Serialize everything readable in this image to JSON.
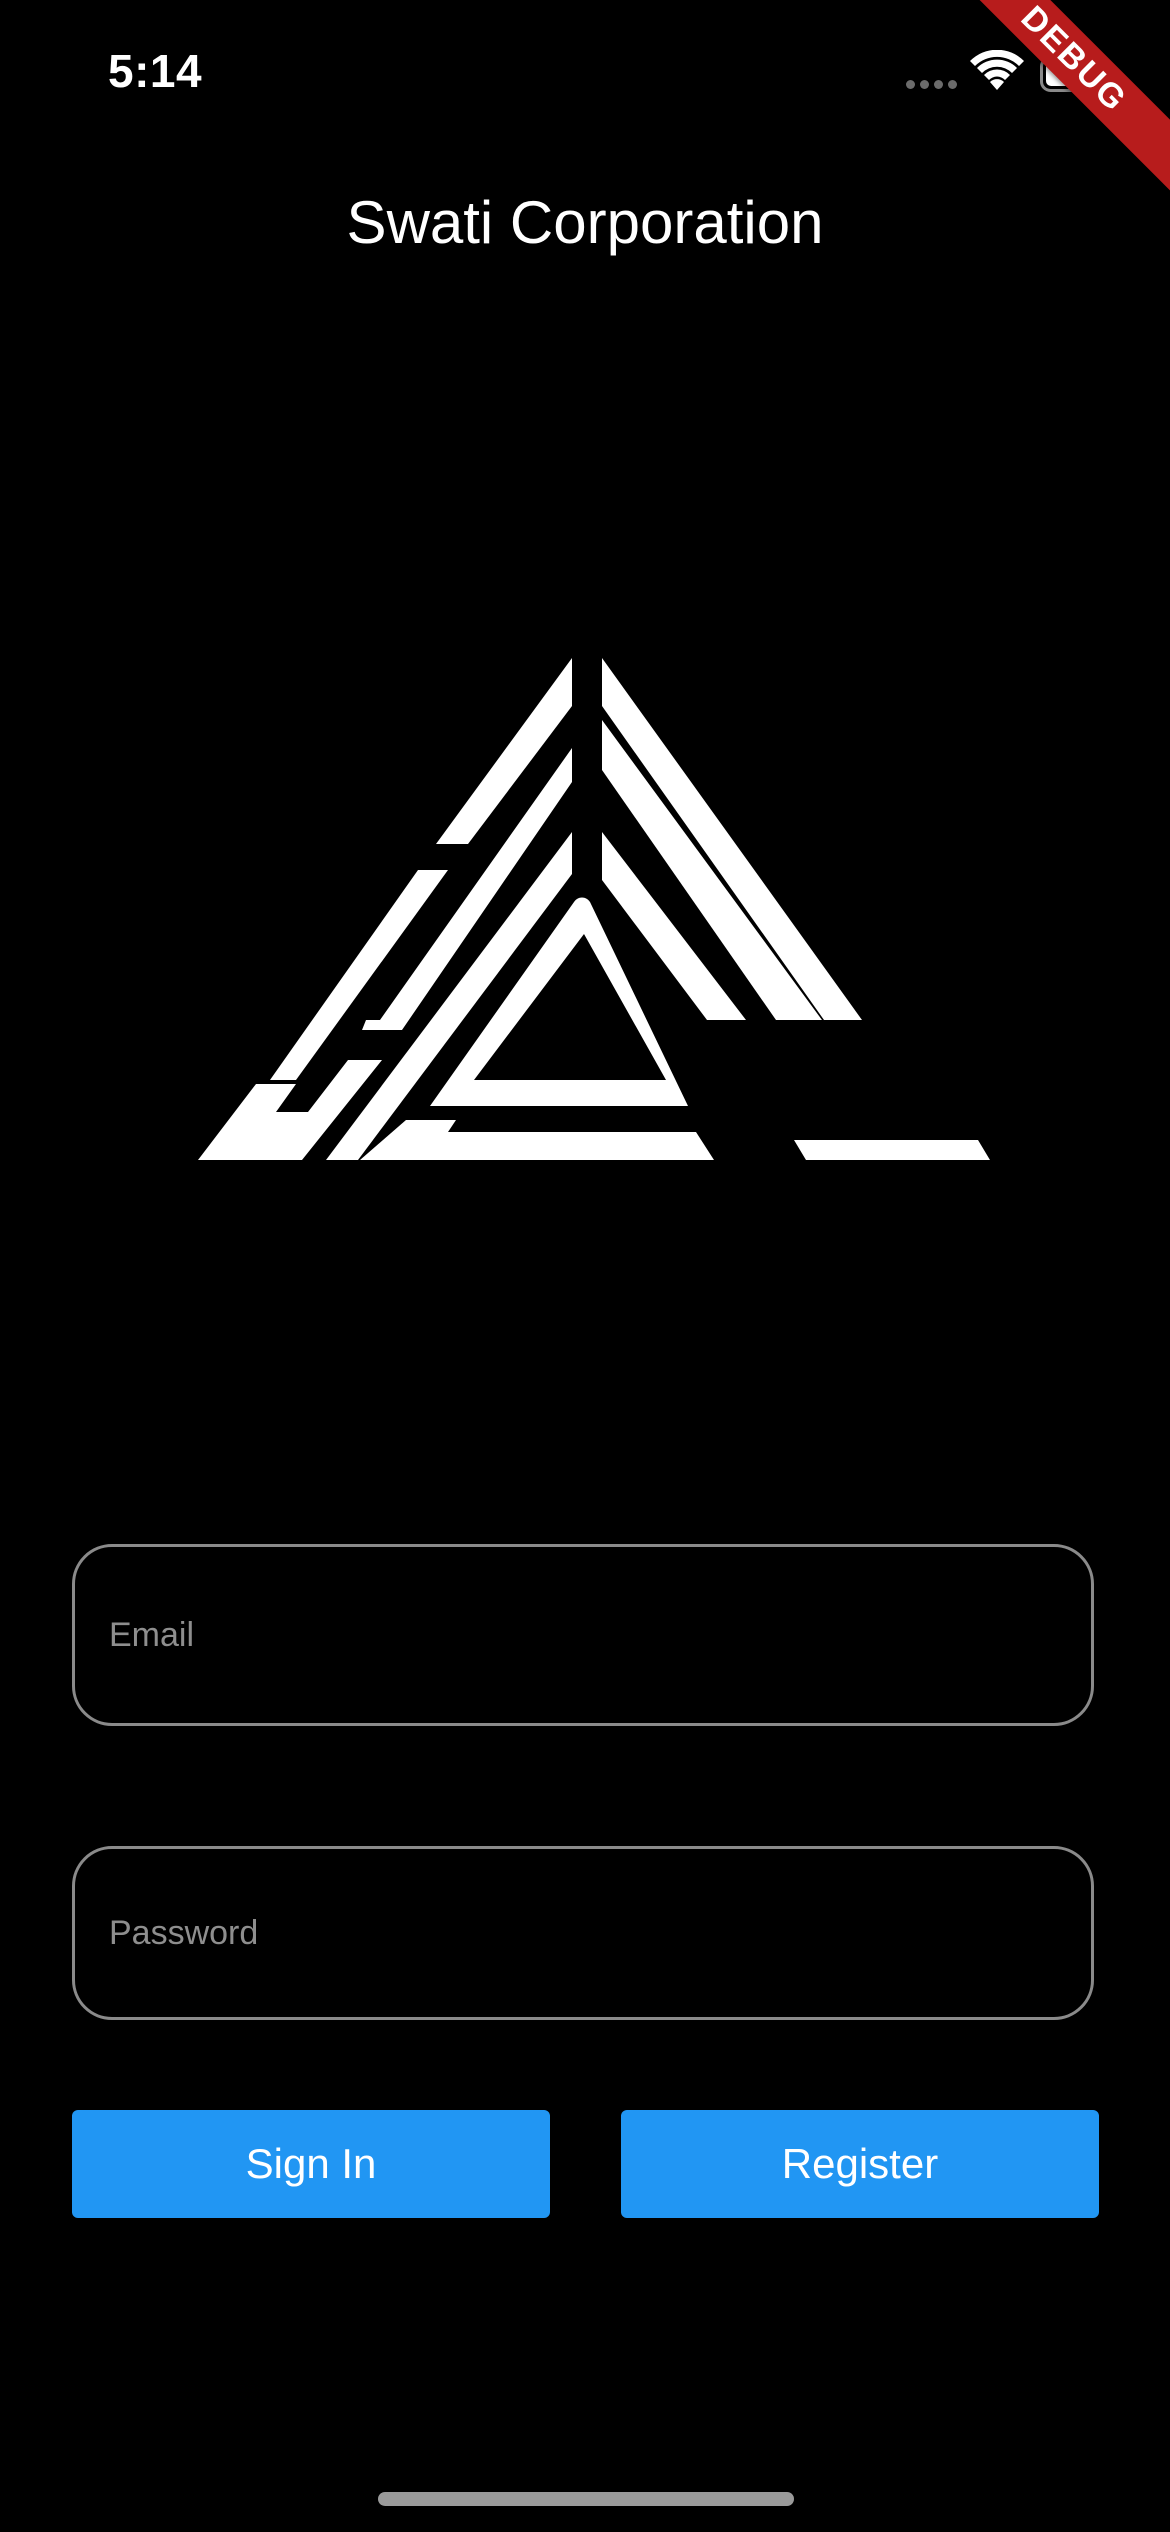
{
  "status_bar": {
    "time": "5:14",
    "icons": [
      "signal-dots-icon",
      "wifi-icon",
      "battery-icon"
    ]
  },
  "debug_banner": {
    "label": "DEBUG",
    "color": "#b71c1c"
  },
  "header": {
    "title": "Swati Corporation"
  },
  "logo": {
    "icon": "triangle-maze-logo-icon",
    "color": "#ffffff"
  },
  "form": {
    "email": {
      "placeholder": "Email",
      "value": ""
    },
    "password": {
      "placeholder": "Password",
      "value": ""
    }
  },
  "actions": {
    "sign_in_label": "Sign In",
    "register_label": "Register",
    "button_color": "#2196f3"
  },
  "theme": {
    "background": "#000000",
    "text": "#ffffff",
    "field_border": "#8a8a8a",
    "placeholder": "#8e8e8e"
  }
}
